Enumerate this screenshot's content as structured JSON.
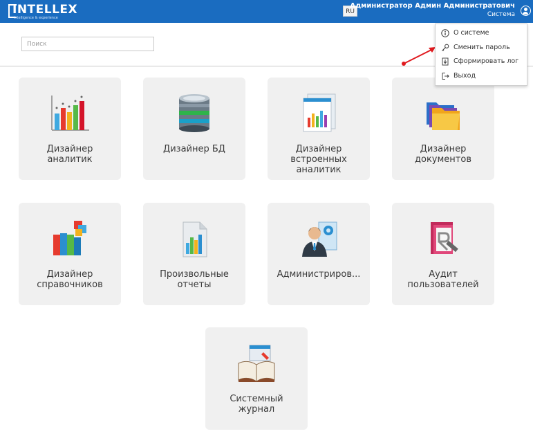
{
  "header": {
    "logo_text": "INTELLEX",
    "logo_tagline": "intelligence & experience",
    "language": "RU",
    "user_name": "Администратор Админ Администратович",
    "user_role": "Система",
    "bg_color": "#1a6cc0"
  },
  "search": {
    "placeholder": "Поиск",
    "value": ""
  },
  "user_menu": {
    "items": [
      {
        "label": "О системе",
        "icon": "info-icon"
      },
      {
        "label": "Сменить пароль",
        "icon": "key-icon"
      },
      {
        "label": "Сформировать лог",
        "icon": "download-log-icon"
      },
      {
        "label": "Выход",
        "icon": "logout-icon"
      }
    ]
  },
  "annotation": {
    "arrow_color": "#e0191e"
  },
  "tiles": [
    {
      "label": "Дизайнер\nаналитик",
      "icon": "bar-chart-icon"
    },
    {
      "label": "Дизайнер БД",
      "icon": "database-icon"
    },
    {
      "label": "Дизайнер\nвстроенных\nаналитик",
      "icon": "embedded-report-icon"
    },
    {
      "label": "Дизайнер\nдокументов",
      "icon": "folders-icon"
    },
    {
      "label": "Дизайнер\nсправочников",
      "icon": "books-icon"
    },
    {
      "label": "Произвольные\nотчеты",
      "icon": "custom-report-icon"
    },
    {
      "label": "Администриров...",
      "icon": "admin-user-icon"
    },
    {
      "label": "Аудит\nпользователей",
      "icon": "audit-icon"
    },
    {
      "label": "Системный\nжурнал",
      "icon": "system-journal-icon"
    }
  ]
}
